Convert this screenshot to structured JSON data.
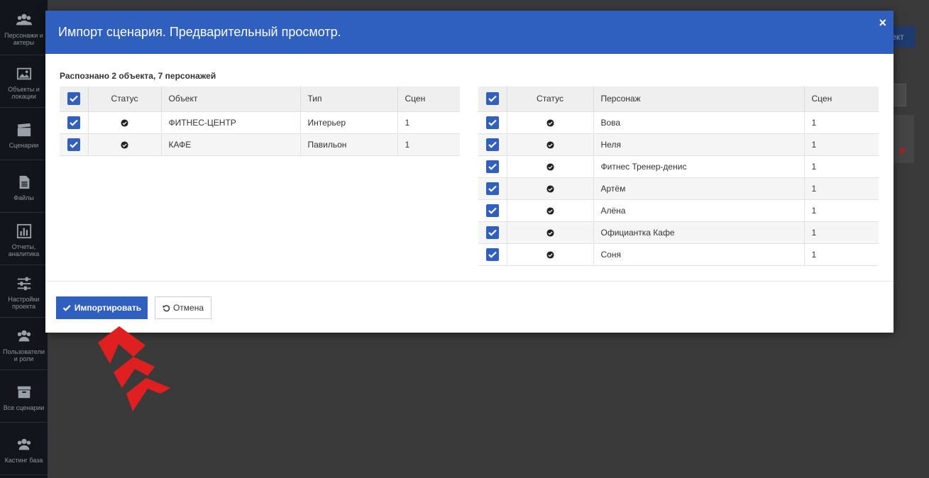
{
  "sidebar": {
    "items": [
      {
        "label": "Персонажи и актеры",
        "icon": "users-icon"
      },
      {
        "label": "Объекты и локации",
        "icon": "image-icon"
      },
      {
        "label": "Сценарии",
        "icon": "clapperboard-icon"
      },
      {
        "label": "Файлы",
        "icon": "file-icon"
      },
      {
        "label": "Отчеты, аналитика",
        "icon": "bar-chart-icon"
      },
      {
        "label": "Настройки проекта",
        "icon": "sliders-icon"
      },
      {
        "label": "Пользователи и роли",
        "icon": "users-icon"
      },
      {
        "label": "Все сценарии",
        "icon": "archive-icon"
      },
      {
        "label": "Кастинг база",
        "icon": "users-icon"
      }
    ]
  },
  "background": {
    "button_label_fragment": "ект"
  },
  "modal": {
    "title": "Импорт сценария. Предварительный просмотр.",
    "close_glyph": "×",
    "summary": "Распознано 2 объекта, 7 персонажей",
    "objects_table": {
      "headers": [
        "Статус",
        "Объект",
        "Тип",
        "Сцен"
      ],
      "rows": [
        {
          "checked": true,
          "status": "ok",
          "object": "ФИТНЕС-ЦЕНТР",
          "type": "Интерьер",
          "scenes": "1"
        },
        {
          "checked": true,
          "status": "ok",
          "object": "КАФЕ",
          "type": "Павильон",
          "scenes": "1"
        }
      ]
    },
    "characters_table": {
      "headers": [
        "Статус",
        "Персонаж",
        "Сцен"
      ],
      "rows": [
        {
          "checked": true,
          "status": "ok",
          "name": "Вова",
          "scenes": "1"
        },
        {
          "checked": true,
          "status": "ok",
          "name": "Неля",
          "scenes": "1"
        },
        {
          "checked": true,
          "status": "ok",
          "name": "Фитнес Тренер-денис",
          "scenes": "1"
        },
        {
          "checked": true,
          "status": "ok",
          "name": "Артём",
          "scenes": "1"
        },
        {
          "checked": true,
          "status": "ok",
          "name": "Алёна",
          "scenes": "1"
        },
        {
          "checked": true,
          "status": "ok",
          "name": "Официантка Кафе",
          "scenes": "1"
        },
        {
          "checked": true,
          "status": "ok",
          "name": "Соня",
          "scenes": "1"
        }
      ]
    },
    "footer": {
      "import_label": "Импортировать",
      "cancel_label": "Отмена"
    }
  },
  "colors": {
    "accent": "#2f5fbf",
    "sidebar_bg": "#12161c",
    "arrow": "#e02020",
    "delete_icon": "#b01e1e"
  }
}
